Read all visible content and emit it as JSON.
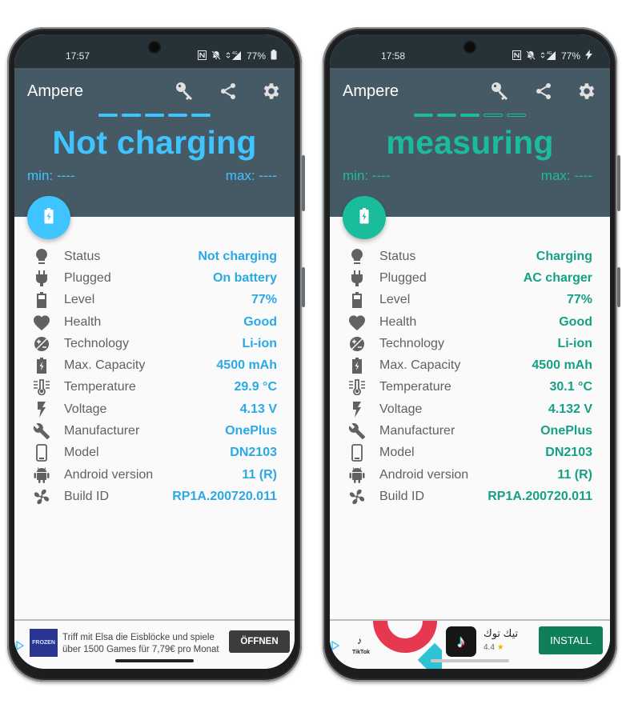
{
  "colors": {
    "statusbar": "#263238",
    "header": "#455a64",
    "left_accent": "#40c4ff",
    "left_value": "#29a9e6",
    "right_accent": "#1abc9c",
    "right_value": "#16a085",
    "label": "#616161",
    "icon": "#616161"
  },
  "phones": [
    {
      "statusbar": {
        "time": "17:57",
        "network": "4G",
        "battery": "77%",
        "battery_icon": "battery-icon"
      },
      "appbar": {
        "title": "Ampere",
        "actions": [
          "key-icon",
          "share-icon",
          "gear-icon"
        ]
      },
      "progress_bars": {
        "filled": 5,
        "total": 5
      },
      "big_status": "Not charging",
      "min_label": "min: ----",
      "max_label": "max: ----",
      "fab_icon": "battery-charging-icon",
      "rows": [
        {
          "icon": "lightbulb-icon",
          "label": "Status",
          "value": "Not charging"
        },
        {
          "icon": "plug-icon",
          "label": "Plugged",
          "value": "On battery"
        },
        {
          "icon": "battery-icon",
          "label": "Level",
          "value": "77%"
        },
        {
          "icon": "heart-icon",
          "label": "Health",
          "value": "Good"
        },
        {
          "icon": "technology-icon",
          "label": "Technology",
          "value": "Li-ion"
        },
        {
          "icon": "battery-charging-icon",
          "label": "Max. Capacity",
          "value": "4500 mAh"
        },
        {
          "icon": "thermometer-icon",
          "label": "Temperature",
          "value": "29.9 °C"
        },
        {
          "icon": "flash-icon",
          "label": "Voltage",
          "value": "4.13 V"
        },
        {
          "icon": "wrench-icon",
          "label": "Manufacturer",
          "value": "OnePlus"
        },
        {
          "icon": "phone-icon",
          "label": "Model",
          "value": "DN2103"
        },
        {
          "icon": "android-icon",
          "label": "Android version",
          "value": "11 (R)"
        },
        {
          "icon": "fan-icon",
          "label": "Build ID",
          "value": "RP1A.200720.011"
        }
      ],
      "ad": {
        "logo_text": "FROZEN",
        "text_line1": "Triff mit Elsa die Eisblöcke und spiele",
        "text_line2": "über 1500 Games für 7,79€ pro Monat",
        "button": "ÖFFNEN"
      }
    },
    {
      "statusbar": {
        "time": "17:58",
        "network": "4G",
        "battery": "77%",
        "battery_icon": "charging-bolt-icon"
      },
      "appbar": {
        "title": "Ampere",
        "actions": [
          "key-icon",
          "share-icon",
          "gear-icon"
        ]
      },
      "progress_bars": {
        "filled": 3,
        "total": 5
      },
      "big_status": "measuring",
      "min_label": "min: ----",
      "max_label": "max: ----",
      "fab_icon": "battery-charging-icon",
      "rows": [
        {
          "icon": "lightbulb-icon",
          "label": "Status",
          "value": "Charging"
        },
        {
          "icon": "plug-icon",
          "label": "Plugged",
          "value": "AC charger"
        },
        {
          "icon": "battery-icon",
          "label": "Level",
          "value": "77%"
        },
        {
          "icon": "heart-icon",
          "label": "Health",
          "value": "Good"
        },
        {
          "icon": "technology-icon",
          "label": "Technology",
          "value": "Li-ion"
        },
        {
          "icon": "battery-charging-icon",
          "label": "Max. Capacity",
          "value": "4500 mAh"
        },
        {
          "icon": "thermometer-icon",
          "label": "Temperature",
          "value": "30.1 °C"
        },
        {
          "icon": "flash-icon",
          "label": "Voltage",
          "value": "4.132 V"
        },
        {
          "icon": "wrench-icon",
          "label": "Manufacturer",
          "value": "OnePlus"
        },
        {
          "icon": "phone-icon",
          "label": "Model",
          "value": "DN2103"
        },
        {
          "icon": "android-icon",
          "label": "Android version",
          "value": "11 (R)"
        },
        {
          "icon": "fan-icon",
          "label": "Build ID",
          "value": "RP1A.200720.011"
        }
      ],
      "ad": {
        "brand_label": "TikTok",
        "app_name": "تيك توك",
        "rating": "4.4",
        "button": "INSTALL"
      }
    }
  ]
}
